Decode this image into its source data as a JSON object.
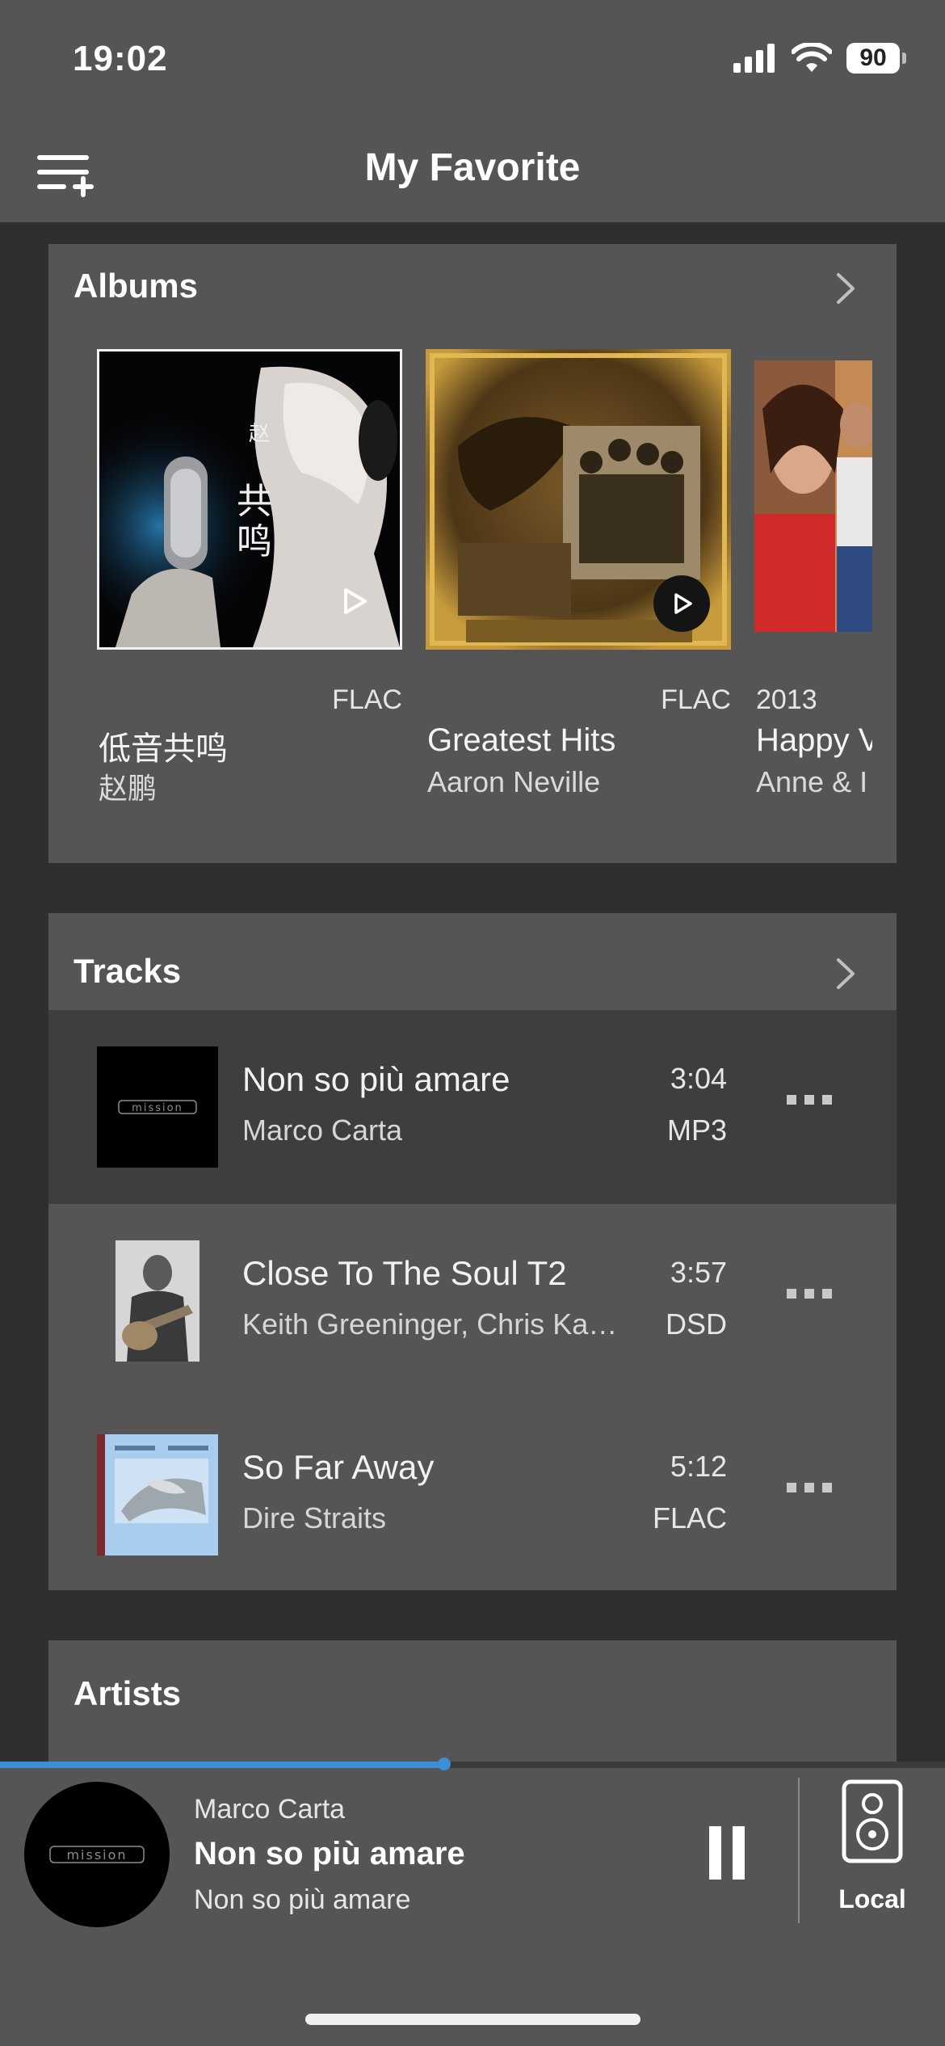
{
  "status_bar": {
    "time": "19:02",
    "battery": "90"
  },
  "nav": {
    "title": "My Favorite"
  },
  "albums": {
    "title": "Albums",
    "items": [
      {
        "title": "低音共鸣",
        "artist": "赵鹏",
        "format": "FLAC",
        "year": ""
      },
      {
        "title": "Greatest Hits",
        "artist": "Aaron Neville",
        "format": "FLAC",
        "year": ""
      },
      {
        "title": "Happy V",
        "artist": "Anne & I",
        "format": "",
        "year": "2013"
      }
    ]
  },
  "tracks": {
    "title": "Tracks",
    "items": [
      {
        "title": "Non so più amare",
        "artist": "Marco Carta",
        "duration": "3:04",
        "format": "MP3"
      },
      {
        "title": "Close To The Soul T2",
        "artist": "Keith Greeninger, Chris Kamler",
        "duration": "3:57",
        "format": "DSD"
      },
      {
        "title": "So Far Away",
        "artist": "Dire Straits",
        "duration": "5:12",
        "format": "FLAC"
      }
    ]
  },
  "artists": {
    "title": "Artists"
  },
  "player": {
    "artist": "Marco Carta",
    "title": "Non so più amare",
    "album": "Non so più amare",
    "progress": 0.47,
    "output_label": "Local"
  },
  "colors": {
    "accent": "#3b8fd4",
    "panel": "#555556",
    "background": "#2f2f30",
    "highlight_row": "#3e3e3f"
  }
}
